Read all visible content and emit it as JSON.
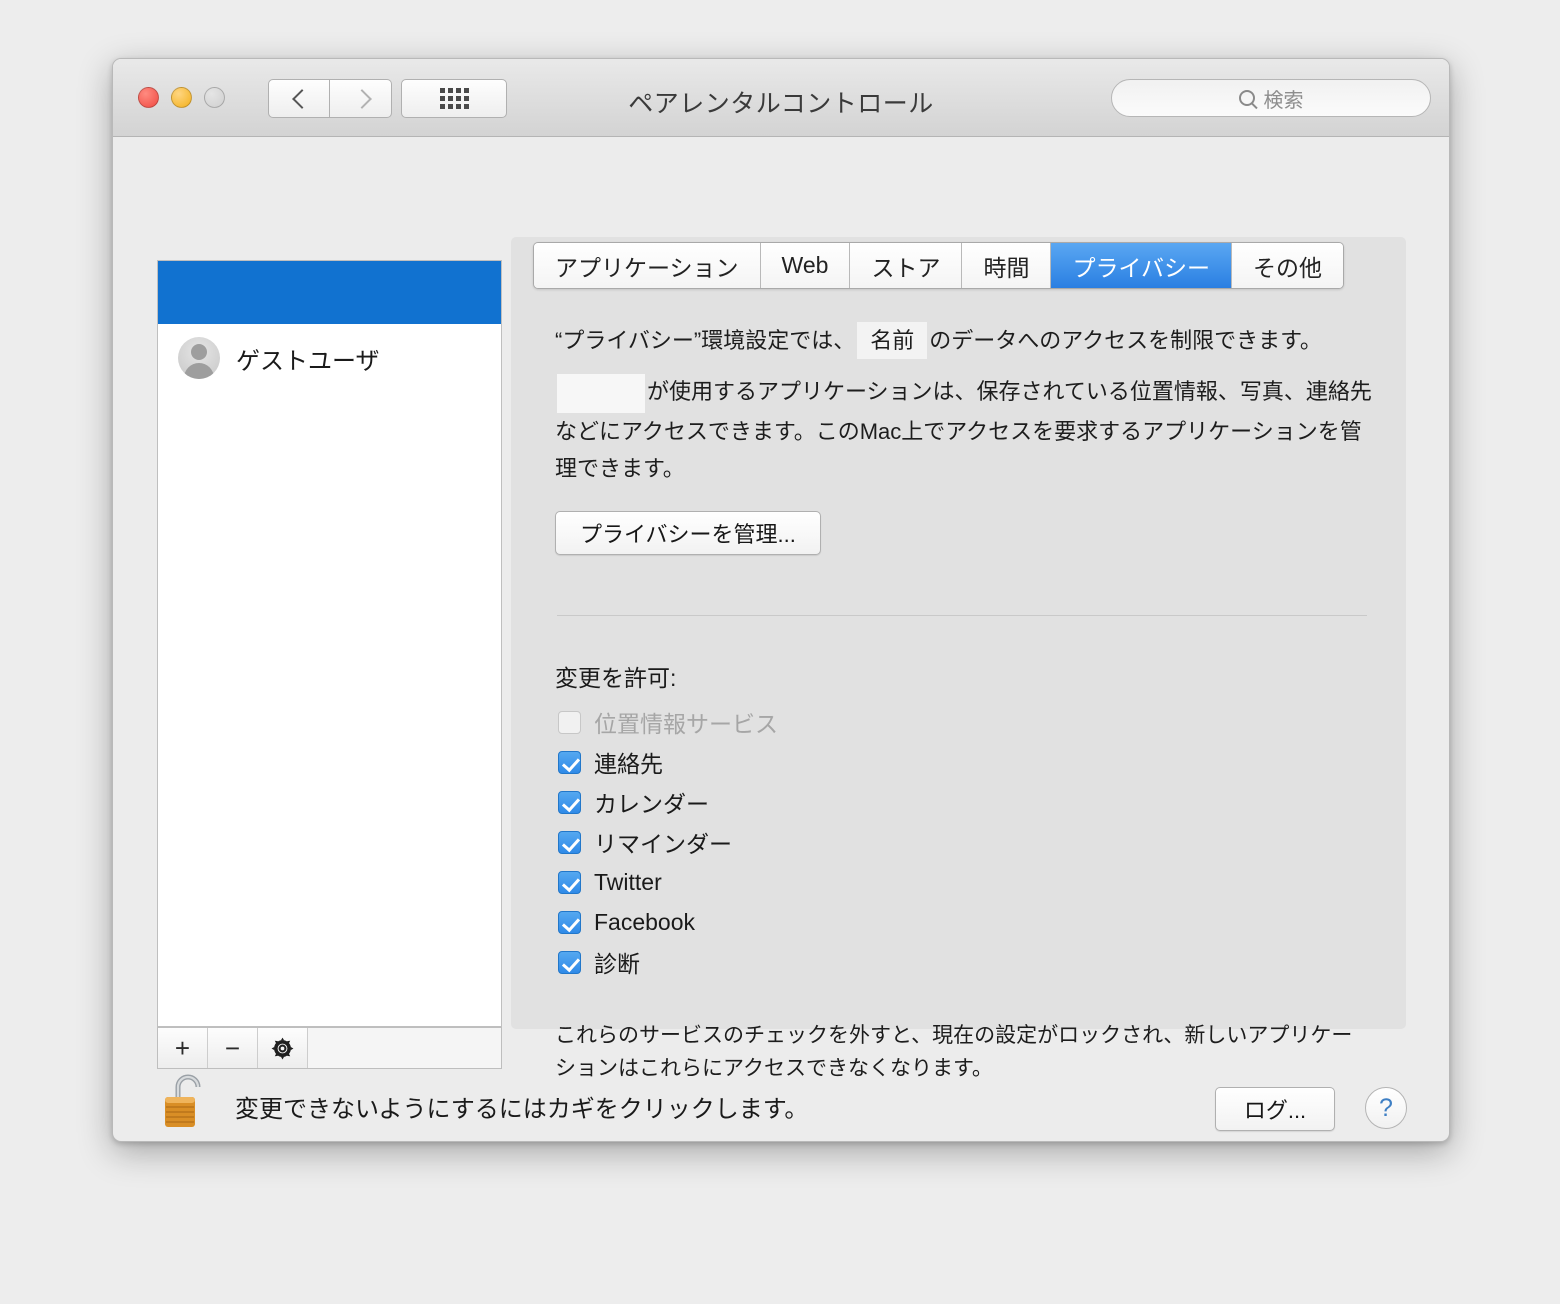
{
  "window": {
    "title": "ペアレンタルコントロール",
    "traffic_lights": [
      "close-button",
      "minimize-button",
      "zoom-button"
    ],
    "nav": {
      "back": "back-button",
      "forward": "forward-button",
      "show_all": "show-all-button"
    }
  },
  "search": {
    "placeholder": "検索",
    "value": ""
  },
  "tabs": [
    {
      "label": "アプリケーション",
      "active": false
    },
    {
      "label": "Web",
      "active": false
    },
    {
      "label": "ストア",
      "active": false
    },
    {
      "label": "時間",
      "active": false
    },
    {
      "label": "プライバシー",
      "active": true
    },
    {
      "label": "その他",
      "active": false
    }
  ],
  "sidebar": {
    "selected_row_label": "",
    "users": [
      {
        "name": "ゲストユーザ"
      }
    ],
    "toolbar": {
      "add_label": "+",
      "remove_label": "−",
      "settings_icon": "gear-icon"
    }
  },
  "content": {
    "description": {
      "part1": "“プライバシー”環境設定では、",
      "highlight_name": "名前",
      "part2": "のデータへのアクセスを制限できます。",
      "part3": "が使用するアプリケーションは、保存されている位置情報、写真、連絡先などにアクセスできます。このMac上でアクセスを要求するアプリケーションを管理できます。"
    },
    "manage_button": "プライバシーを管理...",
    "allow_label": "変更を許可:",
    "checkboxes": [
      {
        "label": "位置情報サービス",
        "checked": false,
        "disabled": true
      },
      {
        "label": "連絡先",
        "checked": true,
        "disabled": false
      },
      {
        "label": "カレンダー",
        "checked": true,
        "disabled": false
      },
      {
        "label": "リマインダー",
        "checked": true,
        "disabled": false
      },
      {
        "label": "Twitter",
        "checked": true,
        "disabled": false
      },
      {
        "label": "Facebook",
        "checked": true,
        "disabled": false
      },
      {
        "label": "診断",
        "checked": true,
        "disabled": false
      }
    ],
    "note": "これらのサービスのチェックを外すと、現在の設定がロックされ、新しいアプリケーションはこれらにアクセスできなくなります。"
  },
  "footer": {
    "lock_icon": "unlocked-padlock-icon",
    "lock_text": "変更できないようにするにはカギをクリックします。",
    "log_button": "ログ...",
    "help_button": "?"
  },
  "colors": {
    "accent_blue": "#2a7fe2",
    "selection_blue": "#1172d0",
    "checkbox_blue": "#2f8ae8",
    "window_bg": "#ececec",
    "panel_bg": "#e1e1e1"
  }
}
